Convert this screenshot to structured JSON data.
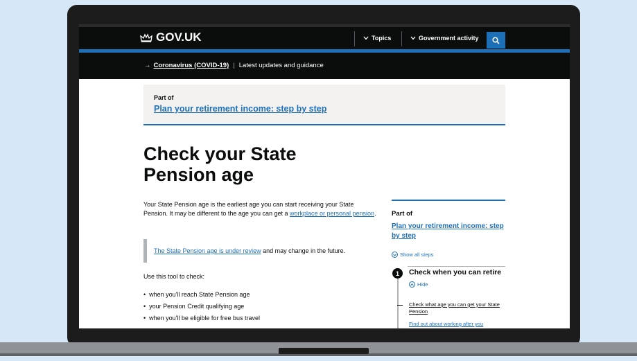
{
  "header": {
    "logo": "GOV.UK",
    "nav": [
      {
        "label": "Topics"
      },
      {
        "label": "Government activity"
      }
    ]
  },
  "banner": {
    "link": "Coronavirus (COVID-19)",
    "text": "Latest updates and guidance"
  },
  "part_of": {
    "label": "Part of",
    "link": "Plan your retirement income: step by step"
  },
  "main": {
    "title": "Check your State Pension age",
    "intro_before": "Your State Pension age is the earliest age you can start receiving your State Pension. It may be different to the age you can get a ",
    "intro_link": "workplace or personal pension",
    "intro_after": ".",
    "inset_link": "The State Pension age is under review",
    "inset_text": " and may change in the future.",
    "use_text": "Use this tool to check:",
    "bullets": [
      "when you'll reach State Pension age",
      "your Pension Credit qualifying age",
      "when you'll be eligible for free bus travel"
    ]
  },
  "sidebar": {
    "part_of": "Part of",
    "link": "Plan your retirement income: step by step",
    "show_all": "Show all steps",
    "step_number": "1",
    "step_title": "Check when you can retire",
    "hide": "Hide",
    "sub_links": [
      "Check what age you can get your State Pension",
      "Find out about working after you"
    ]
  },
  "colors": {
    "header_bg": "#0b0c0c",
    "link": "#1d70b8",
    "background": "#d6e8f8"
  }
}
